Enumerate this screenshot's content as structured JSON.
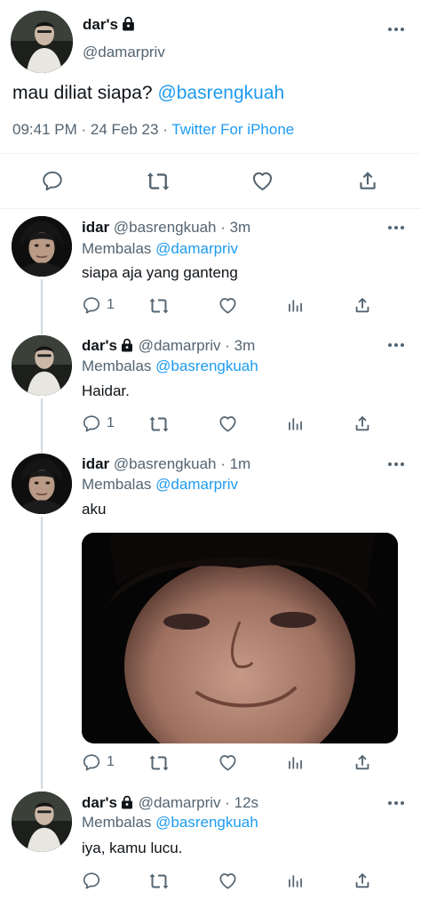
{
  "main_tweet": {
    "display_name": "dar's",
    "handle": "@damarpriv",
    "text_prefix": "mau diliat siapa?",
    "text_mention": "@basrengkuah",
    "time": "09:41 PM",
    "date_sep": "·",
    "date": "24 Feb 23",
    "source_sep": "·",
    "source": "Twitter For iPhone"
  },
  "replies": [
    {
      "display_name": "idar",
      "handle": "@basrengkuah",
      "time": "· 3m",
      "replying_label": "Membalas",
      "replying_to": "@damarpriv",
      "text": "siapa aja yang ganteng",
      "reply_count": "1",
      "locked": false
    },
    {
      "display_name": "dar's",
      "handle": "@damarpriv",
      "time": "· 3m",
      "replying_label": "Membalas",
      "replying_to": "@basrengkuah",
      "text": "Haidar.",
      "reply_count": "1",
      "locked": true
    },
    {
      "display_name": "idar",
      "handle": "@basrengkuah",
      "time": "· 1m",
      "replying_label": "Membalas",
      "replying_to": "@damarpriv",
      "text": "aku",
      "reply_count": "1",
      "locked": false,
      "has_image": true
    },
    {
      "display_name": "dar's",
      "handle": "@damarpriv",
      "time": "· 12s",
      "replying_label": "Membalas",
      "replying_to": "@basrengkuah",
      "text": "iya, kamu lucu.",
      "reply_count": "",
      "locked": true
    }
  ],
  "colors": {
    "link": "#1d9bf0",
    "secondary": "#536471",
    "primary": "#0f1419",
    "divider": "#eff3f4"
  },
  "icons": [
    "lock-icon",
    "more-icon",
    "reply-icon",
    "retweet-icon",
    "like-icon",
    "views-icon",
    "share-icon"
  ]
}
